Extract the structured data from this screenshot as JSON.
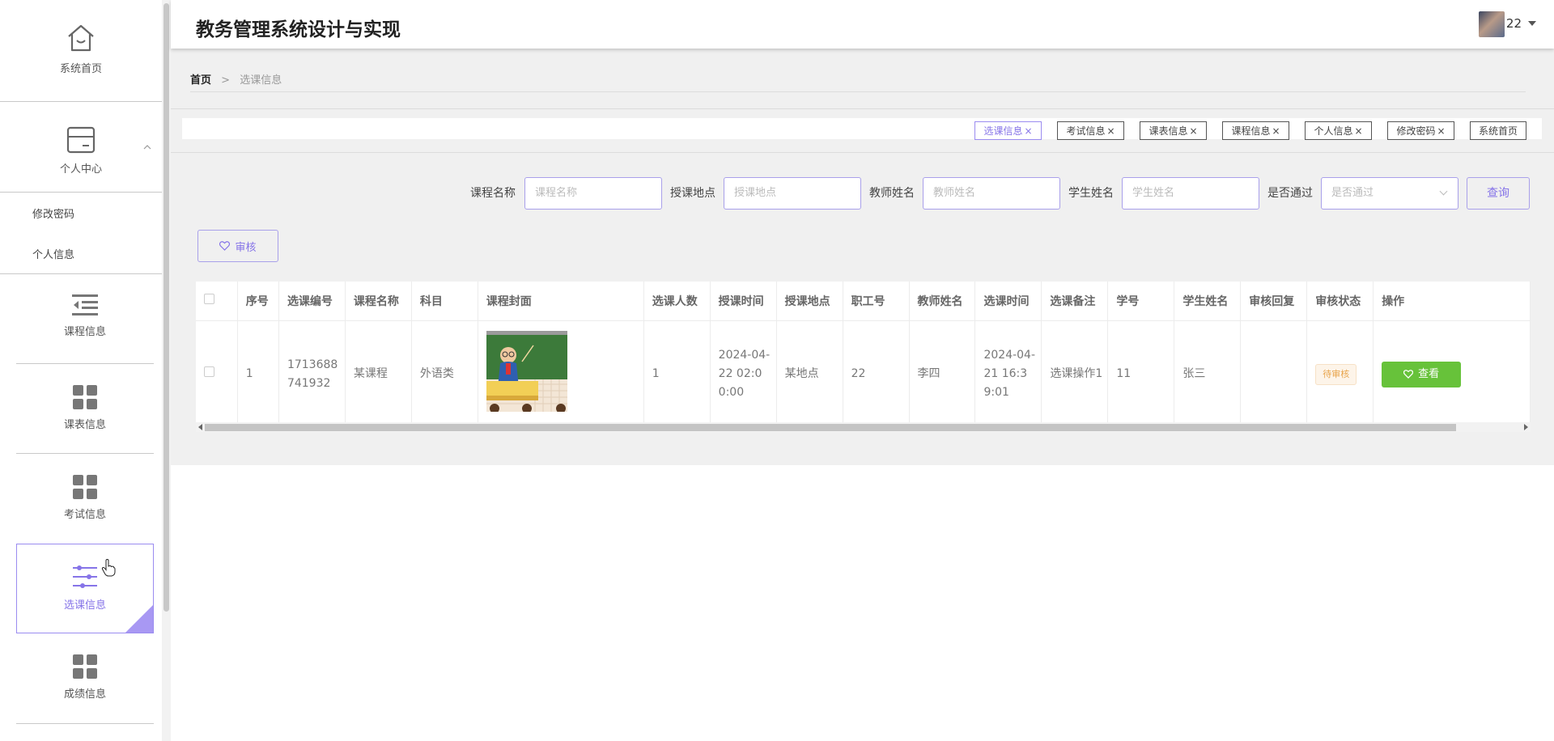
{
  "sidebar": {
    "home_label": "系统首页",
    "personal_center_label": "个人中心",
    "sub_items": [
      "修改密码",
      "个人信息"
    ],
    "menu_items": [
      {
        "label": "课程信息",
        "icon": "list-indent-icon"
      },
      {
        "label": "课表信息",
        "icon": "grid-icon"
      },
      {
        "label": "考试信息",
        "icon": "grid-icon"
      },
      {
        "label": "选课信息",
        "icon": "sliders-icon",
        "active": true
      },
      {
        "label": "成绩信息",
        "icon": "grid-icon"
      }
    ]
  },
  "header": {
    "title": "教务管理系统设计与实现",
    "username": "22"
  },
  "breadcrumb": {
    "home": "首页",
    "separator": ">",
    "current": "选课信息"
  },
  "tags": [
    {
      "label": "选课信息",
      "closable": true,
      "active": true
    },
    {
      "label": "考试信息",
      "closable": true
    },
    {
      "label": "课表信息",
      "closable": true
    },
    {
      "label": "课程信息",
      "closable": true
    },
    {
      "label": "个人信息",
      "closable": true
    },
    {
      "label": "修改密码",
      "closable": true
    },
    {
      "label": "系统首页",
      "closable": false
    }
  ],
  "search": {
    "course_name_label": "课程名称",
    "course_name_placeholder": "课程名称",
    "location_label": "授课地点",
    "location_placeholder": "授课地点",
    "teacher_label": "教师姓名",
    "teacher_placeholder": "教师姓名",
    "student_label": "学生姓名",
    "student_placeholder": "学生姓名",
    "passed_label": "是否通过",
    "passed_placeholder": "是否通过",
    "query_button": "查询"
  },
  "audit_button": "审核",
  "table": {
    "headers": [
      "序号",
      "选课编号",
      "课程名称",
      "科目",
      "课程封面",
      "选课人数",
      "授课时间",
      "授课地点",
      "职工号",
      "教师姓名",
      "选课时间",
      "选课备注",
      "学号",
      "学生姓名",
      "审核回复",
      "审核状态",
      "操作"
    ],
    "rows": [
      {
        "index": "1",
        "selection_id": "1713688741932",
        "course_name": "某课程",
        "subject": "外语类",
        "enroll_count": "1",
        "teach_time": "2024-04-22 02:00:00",
        "location": "某地点",
        "staff_no": "22",
        "teacher": "李四",
        "select_time": "2024-04-21 16:39:01",
        "remark": "选课操作1",
        "student_no": "11",
        "student_name": "张三",
        "audit_reply": "",
        "audit_status": "待审核",
        "action": "查看"
      }
    ]
  },
  "colors": {
    "accent": "#8674e8",
    "success": "#67c23a",
    "warning": "#e8a44a"
  }
}
